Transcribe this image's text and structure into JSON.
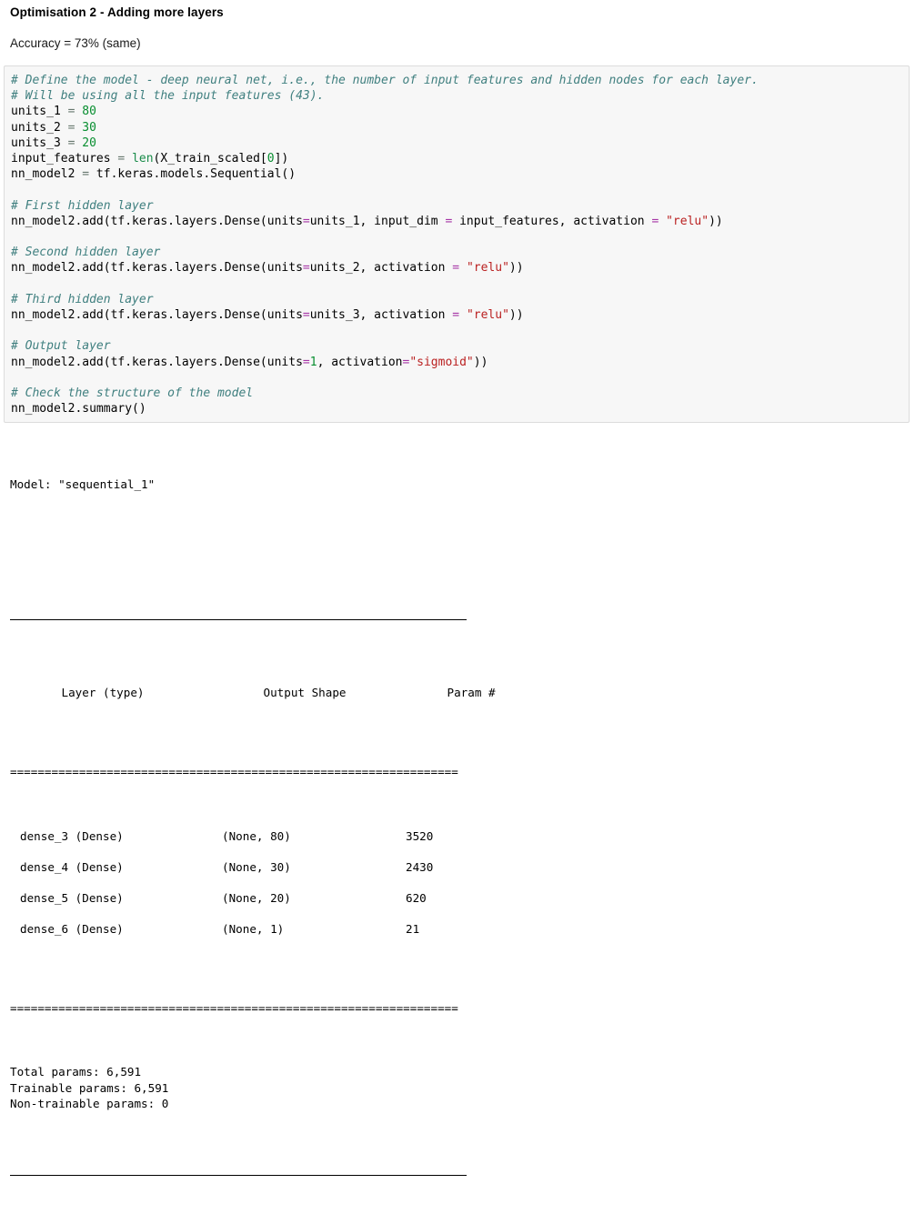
{
  "notebook": {
    "markdown": {
      "heading": "Optimisation 2 - Adding more layers",
      "accuracy_text": "Accuracy = 73% (same)"
    },
    "code_cell": {
      "language": "python",
      "background_color": "#f7f7f7",
      "border_color": "#dcdcdc",
      "comment_color": "#3f7f7f",
      "string_color": "#ba2121",
      "number_color": "#088e30",
      "kwarg_color": "#a636a6",
      "lines": [
        {
          "segments": [
            {
              "t": "# Define the model - deep neural net, i.e., the number of input features and hidden nodes for each layer.",
              "c": "comment"
            }
          ]
        },
        {
          "segments": [
            {
              "t": "# Will be using all the input features (43).",
              "c": "comment"
            }
          ]
        },
        {
          "segments": [
            {
              "t": "units_1 ",
              "c": "plain"
            },
            {
              "t": "=",
              "c": "op"
            },
            {
              "t": " ",
              "c": "plain"
            },
            {
              "t": "80",
              "c": "number"
            }
          ]
        },
        {
          "segments": [
            {
              "t": "units_2 ",
              "c": "plain"
            },
            {
              "t": "=",
              "c": "op"
            },
            {
              "t": " ",
              "c": "plain"
            },
            {
              "t": "30",
              "c": "number"
            }
          ]
        },
        {
          "segments": [
            {
              "t": "units_3 ",
              "c": "plain"
            },
            {
              "t": "=",
              "c": "op"
            },
            {
              "t": " ",
              "c": "plain"
            },
            {
              "t": "20",
              "c": "number"
            }
          ]
        },
        {
          "segments": [
            {
              "t": "input_features ",
              "c": "plain"
            },
            {
              "t": "=",
              "c": "op"
            },
            {
              "t": " ",
              "c": "plain"
            },
            {
              "t": "len",
              "c": "builtin"
            },
            {
              "t": "(X_train_scaled[",
              "c": "plain"
            },
            {
              "t": "0",
              "c": "number"
            },
            {
              "t": "])",
              "c": "plain"
            }
          ]
        },
        {
          "segments": [
            {
              "t": "nn_model2 ",
              "c": "plain"
            },
            {
              "t": "=",
              "c": "op"
            },
            {
              "t": " tf.keras.models.Sequential()",
              "c": "plain"
            }
          ]
        },
        {
          "segments": [
            {
              "t": "",
              "c": "plain"
            }
          ]
        },
        {
          "segments": [
            {
              "t": "# First hidden layer",
              "c": "comment"
            }
          ]
        },
        {
          "segments": [
            {
              "t": "nn_model2.add(tf.keras.layers.Dense(units",
              "c": "plain"
            },
            {
              "t": "=",
              "c": "kwarg"
            },
            {
              "t": "units_1, input_dim ",
              "c": "plain"
            },
            {
              "t": "=",
              "c": "kwarg"
            },
            {
              "t": " input_features, activation ",
              "c": "plain"
            },
            {
              "t": "=",
              "c": "kwarg"
            },
            {
              "t": " ",
              "c": "plain"
            },
            {
              "t": "\"relu\"",
              "c": "string"
            },
            {
              "t": "))",
              "c": "plain"
            }
          ]
        },
        {
          "segments": [
            {
              "t": "",
              "c": "plain"
            }
          ]
        },
        {
          "segments": [
            {
              "t": "# Second hidden layer",
              "c": "comment"
            }
          ]
        },
        {
          "segments": [
            {
              "t": "nn_model2.add(tf.keras.layers.Dense(units",
              "c": "plain"
            },
            {
              "t": "=",
              "c": "kwarg"
            },
            {
              "t": "units_2, activation ",
              "c": "plain"
            },
            {
              "t": "=",
              "c": "kwarg"
            },
            {
              "t": " ",
              "c": "plain"
            },
            {
              "t": "\"relu\"",
              "c": "string"
            },
            {
              "t": "))",
              "c": "plain"
            }
          ]
        },
        {
          "segments": [
            {
              "t": "",
              "c": "plain"
            }
          ]
        },
        {
          "segments": [
            {
              "t": "# Third hidden layer",
              "c": "comment"
            }
          ]
        },
        {
          "segments": [
            {
              "t": "nn_model2.add(tf.keras.layers.Dense(units",
              "c": "plain"
            },
            {
              "t": "=",
              "c": "kwarg"
            },
            {
              "t": "units_3, activation ",
              "c": "plain"
            },
            {
              "t": "=",
              "c": "kwarg"
            },
            {
              "t": " ",
              "c": "plain"
            },
            {
              "t": "\"relu\"",
              "c": "string"
            },
            {
              "t": "))",
              "c": "plain"
            }
          ]
        },
        {
          "segments": [
            {
              "t": "",
              "c": "plain"
            }
          ]
        },
        {
          "segments": [
            {
              "t": "# Output layer",
              "c": "comment"
            }
          ]
        },
        {
          "segments": [
            {
              "t": "nn_model2.add(tf.keras.layers.Dense(units",
              "c": "plain"
            },
            {
              "t": "=",
              "c": "kwarg"
            },
            {
              "t": "1",
              "c": "number"
            },
            {
              "t": ", activation",
              "c": "plain"
            },
            {
              "t": "=",
              "c": "kwarg"
            },
            {
              "t": "\"sigmoid\"",
              "c": "string"
            },
            {
              "t": "))",
              "c": "plain"
            }
          ]
        },
        {
          "segments": [
            {
              "t": "",
              "c": "plain"
            }
          ]
        },
        {
          "segments": [
            {
              "t": "# Check the structure of the model",
              "c": "comment"
            }
          ]
        },
        {
          "segments": [
            {
              "t": "nn_model2.summary()",
              "c": "plain"
            }
          ]
        }
      ]
    },
    "output": {
      "model_title": "Model: \"sequential_1\"",
      "equals_rule": "=================================================================",
      "columns": {
        "layer": "Layer (type)",
        "output_shape": "Output Shape",
        "param": "Param #"
      },
      "rows": [
        {
          "layer": "dense_3 (Dense)",
          "output_shape": "(None, 80)",
          "param": "3520"
        },
        {
          "layer": "dense_4 (Dense)",
          "output_shape": "(None, 30)",
          "param": "2430"
        },
        {
          "layer": "dense_5 (Dense)",
          "output_shape": "(None, 20)",
          "param": "620"
        },
        {
          "layer": "dense_6 (Dense)",
          "output_shape": "(None, 1)",
          "param": "21"
        }
      ],
      "totals": [
        "Total params: 6,591",
        "Trainable params: 6,591",
        "Non-trainable params: 0"
      ]
    }
  }
}
